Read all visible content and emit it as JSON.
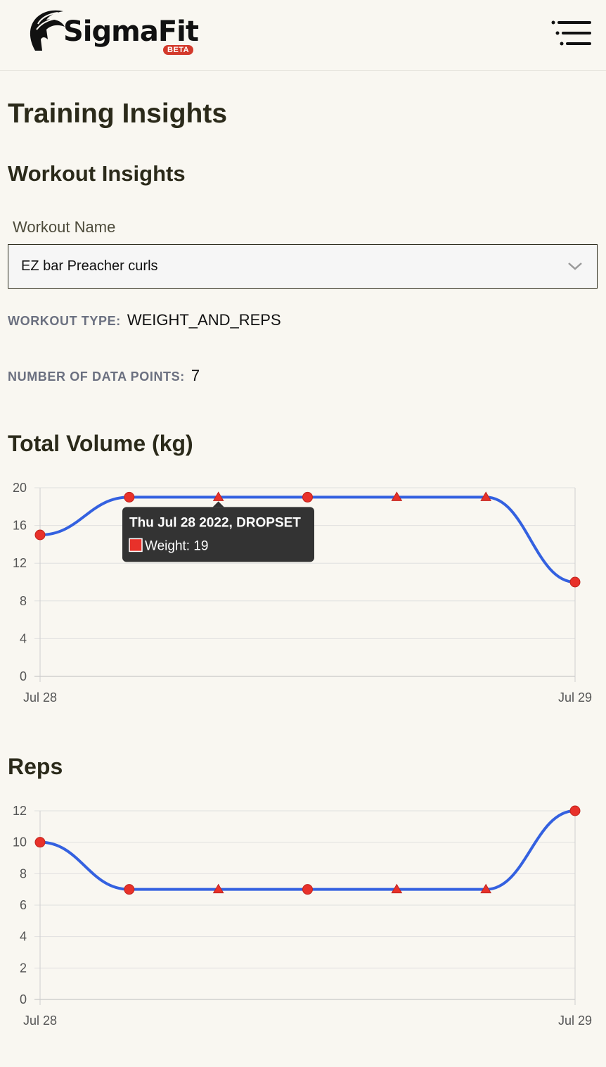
{
  "app": {
    "name": "SigmaFit",
    "badge": "BETA"
  },
  "page": {
    "title": "Training Insights"
  },
  "section": {
    "title": "Workout Insights"
  },
  "workout_select": {
    "label": "Workout Name",
    "value": "EZ bar Preacher curls"
  },
  "meta": {
    "type_label": "WORKOUT TYPE:",
    "type_value": "WEIGHT_AND_REPS",
    "points_label": "NUMBER OF DATA POINTS:",
    "points_value": "7"
  },
  "colors": {
    "line": "#3461e0",
    "marker": "#e8312a",
    "tooltip_bg": "#333333"
  },
  "icons": {
    "menu": "menu-lines-icon",
    "select": "chevron-down-icon",
    "logo": "spartan-helmet-icon"
  },
  "chart_data": [
    {
      "type": "line",
      "title": "Total Volume (kg)",
      "x_ticks": [
        "Jul 28",
        "Jul 29"
      ],
      "ylim": [
        0,
        20
      ],
      "y_ticks": [
        0,
        4,
        8,
        12,
        16,
        20
      ],
      "values": [
        15,
        19,
        19,
        19,
        19,
        19,
        10
      ],
      "markers": [
        "circle",
        "circle",
        "triangle",
        "circle",
        "triangle",
        "triangle",
        "circle"
      ],
      "grid": true,
      "tooltip": {
        "title": "Thu Jul 28 2022, DROPSET",
        "label": "Weight: 19"
      }
    },
    {
      "type": "line",
      "title": "Reps",
      "x_ticks": [
        "Jul 28",
        "Jul 29"
      ],
      "ylim": [
        0,
        12
      ],
      "y_ticks": [
        0,
        2,
        4,
        6,
        8,
        10,
        12
      ],
      "values": [
        10,
        7,
        7,
        7,
        7,
        7,
        12
      ],
      "markers": [
        "circle",
        "circle",
        "triangle",
        "circle",
        "triangle",
        "triangle",
        "circle"
      ],
      "grid": true
    }
  ]
}
